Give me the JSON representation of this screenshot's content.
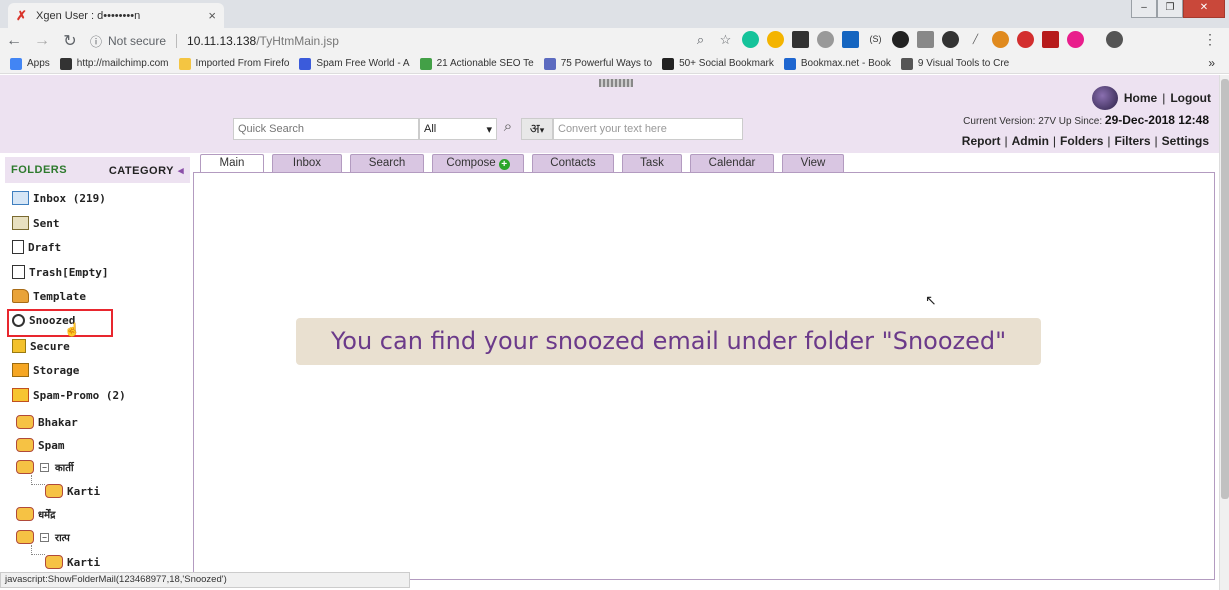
{
  "browser": {
    "tab_title": "Xgen User : d••••••••n",
    "tab_close": "×",
    "security_label": "Not secure",
    "url_host": "10.11.13.138",
    "url_path": "/TyHtmMain.jsp",
    "bookmarks": [
      {
        "label": "Apps",
        "color": "#4285f4"
      },
      {
        "label": "http://mailchimp.com",
        "color": "#333333"
      },
      {
        "label": "Imported From Firefo",
        "color": "#f4c542"
      },
      {
        "label": "Spam Free World - A",
        "color": "#3b5bdb"
      },
      {
        "label": "21 Actionable SEO Te",
        "color": "#43a047"
      },
      {
        "label": "75 Powerful Ways to",
        "color": "#5c6bc0"
      },
      {
        "label": "50+ Social Bookmark",
        "color": "#222222"
      },
      {
        "label": "Bookmax.net - Book",
        "color": "#1e66d0"
      },
      {
        "label": "9 Visual Tools to Cre",
        "color": "#555555"
      }
    ],
    "status_bar": "javascript:ShowFolderMail(123468977,18,'Snoozed')"
  },
  "header": {
    "search_placeholder": "Quick Search",
    "search_scope": "All",
    "lang_button": "अ",
    "convert_placeholder": "Convert your text here",
    "home_link": "Home",
    "logout_link": "Logout",
    "version_text": "Current Version: 27V Up Since:",
    "version_date": "29-Dec-2018 12:48",
    "admin_links": [
      "Report",
      "Admin",
      "Folders",
      "Filters",
      "Settings"
    ]
  },
  "sidebar": {
    "folders_label": "FOLDERS",
    "category_label": "CATEGORY",
    "items": [
      {
        "label": "Inbox (219)",
        "icon": "inbox-icon"
      },
      {
        "label": "Sent",
        "icon": "sent-icon"
      },
      {
        "label": "Draft",
        "icon": "draft-icon"
      },
      {
        "label": "Trash[Empty]",
        "icon": "trash-icon"
      },
      {
        "label": "Template",
        "icon": "folder-icon"
      },
      {
        "label": "Snoozed",
        "icon": "alarm-clock-icon"
      },
      {
        "label": "Secure",
        "icon": "lock-icon"
      },
      {
        "label": "Storage",
        "icon": "storage-icon"
      },
      {
        "label": "Spam-Promo (2)",
        "icon": "spam-icon"
      }
    ],
    "user_folders": [
      {
        "label": "Bhakar"
      },
      {
        "label": "Spam"
      },
      {
        "label": "कार्ती"
      },
      {
        "label": "Karti"
      },
      {
        "label": "धर्मेंद्र"
      },
      {
        "label": "रात्प"
      },
      {
        "label": "Karti"
      }
    ]
  },
  "tabs": [
    "Main",
    "Inbox",
    "Search",
    "Compose",
    "Contacts",
    "Task",
    "Calendar",
    "View"
  ],
  "main": {
    "toast": "You can find your snoozed email under folder \"Snoozed\""
  },
  "colors": {
    "header_bg": "#ede2f1",
    "tab_bg": "#d9c6e2",
    "toast_text": "#6b3a8a",
    "highlight_border": "#e8262e"
  }
}
